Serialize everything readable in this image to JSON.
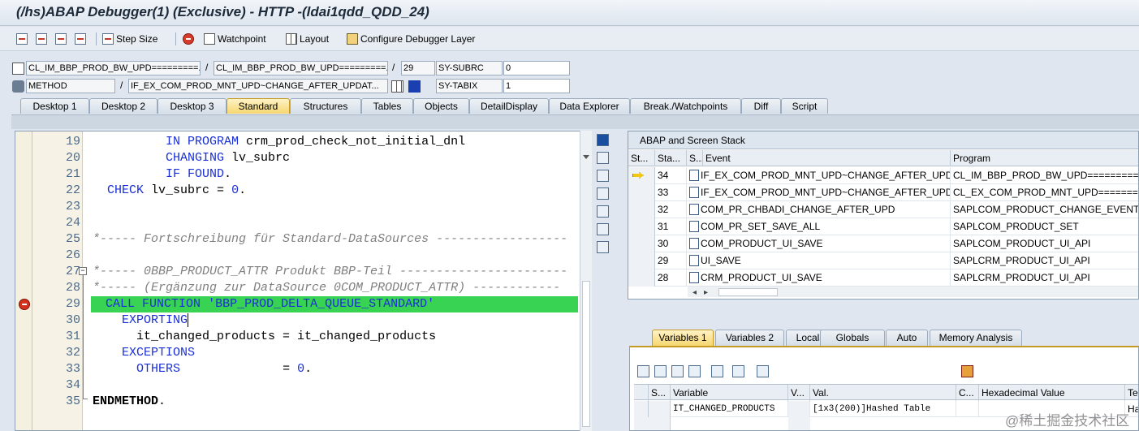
{
  "window": {
    "title": "(/hs)ABAP Debugger(1)  (Exclusive) - HTTP -(ldai1qdd_QDD_24)"
  },
  "toolbar": {
    "step_size": "Step Size",
    "watchpoint": "Watchpoint",
    "layout": "Layout",
    "configure": "Configure Debugger Layer"
  },
  "context": {
    "program": "CL_IM_BBP_PROD_BW_UPD=========...",
    "include": "CL_IM_BBP_PROD_BW_UPD=========...",
    "line": "29",
    "sysubrc_label": "SY-SUBRC",
    "sysubrc_value": "0",
    "proc_type": "METHOD",
    "proc_name": "IF_EX_COM_PROD_MNT_UPD~CHANGE_AFTER_UPDAT...",
    "sytabix_label": "SY-TABIX",
    "sytabix_value": "1",
    "slash": "/"
  },
  "tabs": [
    "Desktop 1",
    "Desktop 2",
    "Desktop 3",
    "Standard",
    "Structures",
    "Tables",
    "Objects",
    "DetailDisplay",
    "Data Explorer",
    "Break./Watchpoints",
    "Diff",
    "Script"
  ],
  "active_tab": "Standard",
  "source": {
    "lines": [
      {
        "n": "19",
        "indent": "          ",
        "parts": [
          [
            "kw",
            "IN PROGRAM"
          ],
          [
            "",
            "crm_prod_check_not_initial_dnl"
          ]
        ]
      },
      {
        "n": "20",
        "indent": "          ",
        "parts": [
          [
            "kw",
            "CHANGING"
          ],
          [
            "",
            "lv_subrc"
          ]
        ]
      },
      {
        "n": "21",
        "indent": "          ",
        "parts": [
          [
            "kw",
            "IF FOUND"
          ],
          [
            "",
            "."
          ]
        ]
      },
      {
        "n": "22",
        "indent": "  ",
        "parts": [
          [
            "kw",
            "CHECK"
          ],
          [
            "",
            "lv_subrc = "
          ],
          [
            "num",
            "0"
          ],
          [
            "",
            "."
          ]
        ]
      },
      {
        "n": "23",
        "indent": "",
        "parts": []
      },
      {
        "n": "24",
        "indent": "",
        "parts": []
      },
      {
        "n": "25",
        "indent": "",
        "parts": [
          [
            "cm",
            "*----- Fortschreibung für Standard-DataSources ------------------"
          ]
        ]
      },
      {
        "n": "26",
        "indent": "",
        "parts": []
      },
      {
        "n": "27",
        "indent": "",
        "parts": [
          [
            "cm",
            "*----- 0BBP_PRODUCT_ATTR Produkt BBP-Teil -----------------------"
          ]
        ]
      },
      {
        "n": "28",
        "indent": "",
        "parts": [
          [
            "cm",
            "*----- (Ergänzung zur DataSource 0COM_PRODUCT_ATTR) ------------"
          ]
        ]
      },
      {
        "n": "29",
        "indent": "  ",
        "parts": [
          [
            "kw",
            "CALL FUNCTION"
          ],
          [
            "str",
            "'BBP_PROD_DELTA_QUEUE_STANDARD'"
          ]
        ]
      },
      {
        "n": "30",
        "indent": "    ",
        "parts": [
          [
            "kw",
            "EXPORTING"
          ]
        ]
      },
      {
        "n": "31",
        "indent": "      ",
        "parts": [
          [
            "",
            "it_changed_products = it_changed_products"
          ]
        ]
      },
      {
        "n": "32",
        "indent": "    ",
        "parts": [
          [
            "kw",
            "EXCEPTIONS"
          ]
        ]
      },
      {
        "n": "33",
        "indent": "      ",
        "parts": [
          [
            "kw",
            "OTHERS"
          ],
          [
            "",
            "             = "
          ],
          [
            "num",
            "0"
          ],
          [
            "",
            "."
          ]
        ]
      },
      {
        "n": "34",
        "indent": "",
        "parts": []
      },
      {
        "n": "35",
        "indent": "",
        "parts": [
          [
            "b",
            "ENDMETHOD"
          ],
          [
            "",
            "."
          ]
        ]
      }
    ]
  },
  "stack": {
    "title": "ABAP and Screen Stack",
    "headers": [
      "St...",
      "Sta...",
      "S...",
      "Event",
      "Program"
    ],
    "rows": [
      {
        "current": true,
        "level": "34",
        "event": "IF_EX_COM_PROD_MNT_UPD~CHANGE_AFTER_UPDA...",
        "program": "CL_IM_BBP_PROD_BW_UPD=========="
      },
      {
        "current": false,
        "level": "33",
        "event": "IF_EX_COM_PROD_MNT_UPD~CHANGE_AFTER_UPDA...",
        "program": "CL_EX_COM_PROD_MNT_UPD========"
      },
      {
        "current": false,
        "level": "32",
        "event": "COM_PR_CHBADI_CHANGE_AFTER_UPD",
        "program": "SAPLCOM_PRODUCT_CHANGE_EVENT"
      },
      {
        "current": false,
        "level": "31",
        "event": "COM_PR_SET_SAVE_ALL",
        "program": "SAPLCOM_PRODUCT_SET"
      },
      {
        "current": false,
        "level": "30",
        "event": "COM_PRODUCT_UI_SAVE",
        "program": "SAPLCOM_PRODUCT_UI_API"
      },
      {
        "current": false,
        "level": "29",
        "event": "UI_SAVE",
        "program": "SAPLCRM_PRODUCT_UI_API"
      },
      {
        "current": false,
        "level": "28",
        "event": "CRM_PRODUCT_UI_SAVE",
        "program": "SAPLCRM_PRODUCT_UI_API"
      }
    ]
  },
  "var_tabs": [
    "Variables 1",
    "Variables 2",
    "Locals",
    "Globals",
    "Auto",
    "Memory Analysis"
  ],
  "active_var_tab": "Variables 1",
  "variables": {
    "headers": [
      "S...",
      "Variable",
      "V...",
      "Val.",
      "C...",
      "Hexadecimal Value",
      "Tec"
    ],
    "rows": [
      {
        "variable": "IT_CHANGED_PRODUCTS",
        "value": "[1x3(200)]Hashed Table",
        "tech": "Hash"
      }
    ]
  },
  "watermark": "@稀土掘金技术社区",
  "colors": {
    "highlight": "#39d353",
    "keyword": "#1a2fd6",
    "comment": "#808080",
    "active_tab": "#f6d770"
  }
}
